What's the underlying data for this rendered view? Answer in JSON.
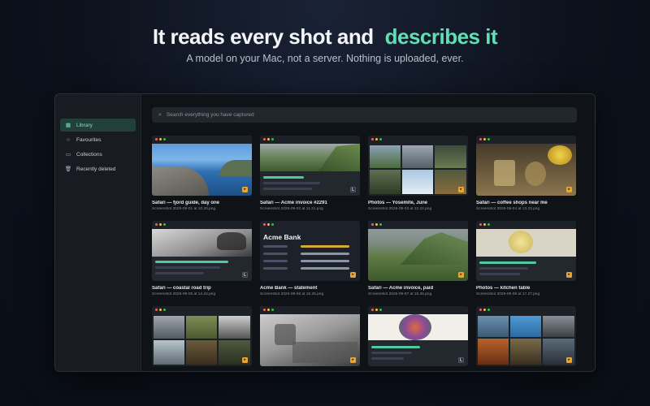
{
  "hero": {
    "title_part1": "It reads every shot and",
    "title_part2": "describes it",
    "subtitle": "A model on your Mac, not a server. Nothing is uploaded, ever."
  },
  "sidebar": {
    "items": [
      {
        "label": "Library",
        "icon": "grid-icon",
        "active": true
      },
      {
        "label": "Favourites",
        "icon": "star-icon",
        "active": false
      },
      {
        "label": "Collections",
        "icon": "folder-icon",
        "active": false
      },
      {
        "label": "Recently deleted",
        "icon": "trash-icon",
        "active": false
      }
    ]
  },
  "search": {
    "placeholder": "Search everything you have captured"
  },
  "cards": [
    {
      "title": "Safari — fjord guide, day one",
      "sub": "Screenshot 2026-09-01 at 10.20.png",
      "badge": "play"
    },
    {
      "title": "Safari — Acme invoice #2291",
      "sub": "Screenshot 2026-09-02 at 11.21.png",
      "badge": "doc"
    },
    {
      "title": "Photos — Yosemite, June",
      "sub": "Screenshot 2026-09-03 at 12.22.png",
      "badge": "play"
    },
    {
      "title": "Safari — coffee shops near me",
      "sub": "Screenshot 2026-09-04 at 13.23.png",
      "badge": "play"
    },
    {
      "title": "Safari — coastal road trip",
      "sub": "Screenshot 2026-09-05 at 14.24.png",
      "badge": "doc"
    },
    {
      "title": "Acme Bank — statement",
      "sub": "Screenshot 2026-09-06 at 15.25.png",
      "badge": "play",
      "bank_name": "Acme Bank"
    },
    {
      "title": "Safari — Acme invoice, paid",
      "sub": "Screenshot 2026-09-07 at 16.26.png",
      "badge": "play"
    },
    {
      "title": "Photos — kitchen table",
      "sub": "Screenshot 2026-09-08 at 17.27.png",
      "badge": "play"
    },
    {
      "title": "",
      "sub": "",
      "badge": "play"
    },
    {
      "title": "",
      "sub": "",
      "badge": "play"
    },
    {
      "title": "",
      "sub": "",
      "badge": "doc"
    },
    {
      "title": "",
      "sub": "",
      "badge": "play"
    }
  ],
  "colors": {
    "accent": "#5fe0b4",
    "sidebar_active_bg": "#22403a",
    "badge_play": "#e8a534",
    "window_bg": "#111419"
  }
}
